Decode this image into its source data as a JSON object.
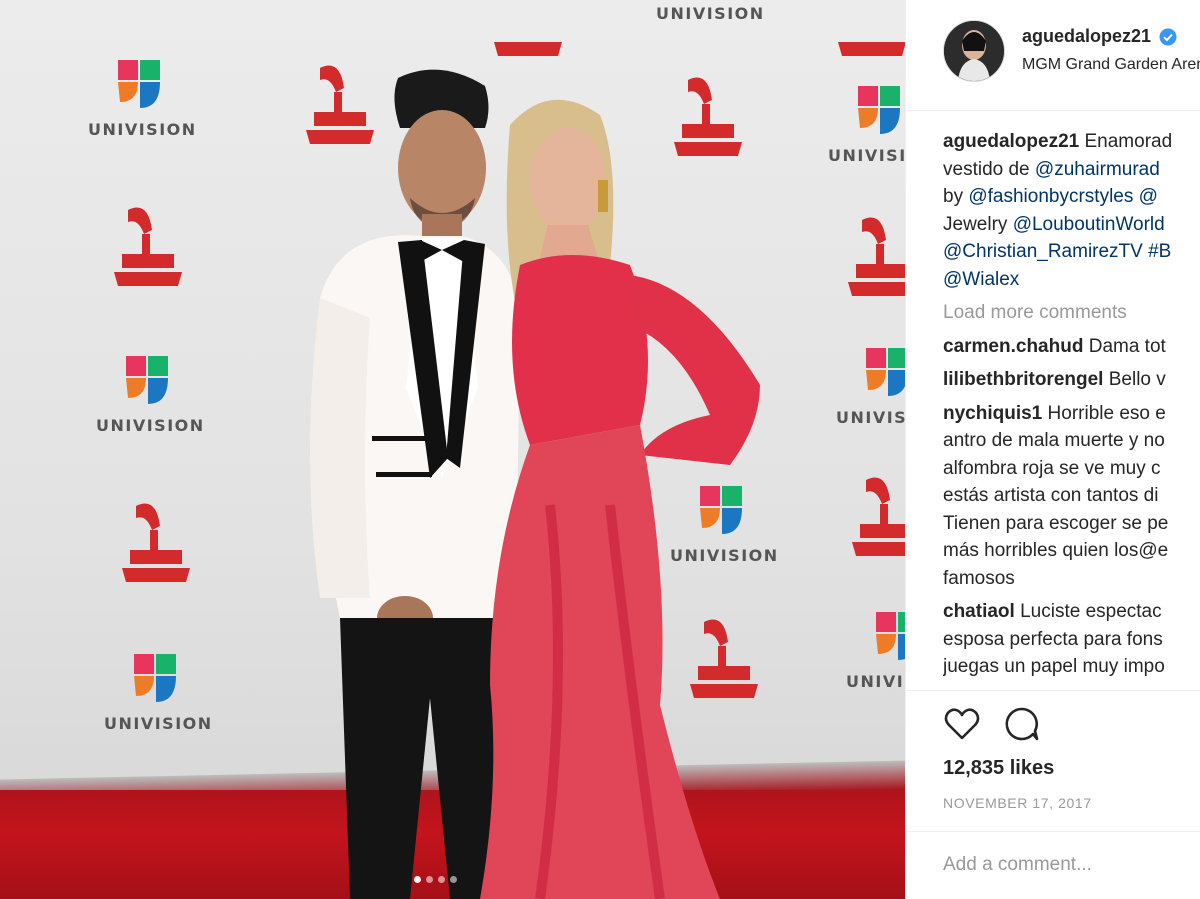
{
  "post": {
    "username": "aguedalopez21",
    "location": "MGM Grand Garden Arena",
    "likes": "12,835 likes",
    "date": "NOVEMBER 17, 2017",
    "add_comment_placeholder": "Add a comment...",
    "load_more": "Load more comments"
  },
  "photo": {
    "backdrop_text": "UNIVISION",
    "carousel_total": 4,
    "carousel_active": 1
  },
  "caption": {
    "user": "aguedalopez21",
    "lines": [
      {
        "text": "Enamorad",
        "mention": ""
      },
      {
        "text": "vestido de ",
        "mention": "@zuhairmurad"
      },
      {
        "text": "by ",
        "mention": "@fashionbycrstyles @"
      },
      {
        "text": "Jewelry ",
        "mention": "@LouboutinWorld"
      },
      {
        "text": "",
        "mention": "@Christian_RamirezTV #B"
      },
      {
        "text": "",
        "mention": "@Wialex"
      }
    ]
  },
  "comments": [
    {
      "user": "carmen.chahud",
      "lines": [
        "Dama tot"
      ]
    },
    {
      "user": "lilibethbritorengel",
      "lines": [
        "Bello v"
      ]
    },
    {
      "user": "nychiquis1",
      "lines": [
        "Horrible eso e",
        "antro de mala muerte y no",
        "alfombra roja se ve muy c",
        "estás artista con tantos di",
        "Tienen para escoger se pe",
        "más horribles quien los@e",
        "famosos"
      ]
    },
    {
      "user": "chatiaol",
      "lines": [
        "Luciste espectac",
        "esposa perfecta para fons",
        "juegas un papel muy impo"
      ]
    }
  ],
  "icons": {
    "like": "heart-icon",
    "comment": "comment-bubble-icon",
    "verified": "verified-badge-icon"
  },
  "colors": {
    "mention": "#003569",
    "muted": "#999999",
    "verified": "#3897f0",
    "carpet": "#b8141c",
    "grammy_red": "#d32b2b"
  }
}
